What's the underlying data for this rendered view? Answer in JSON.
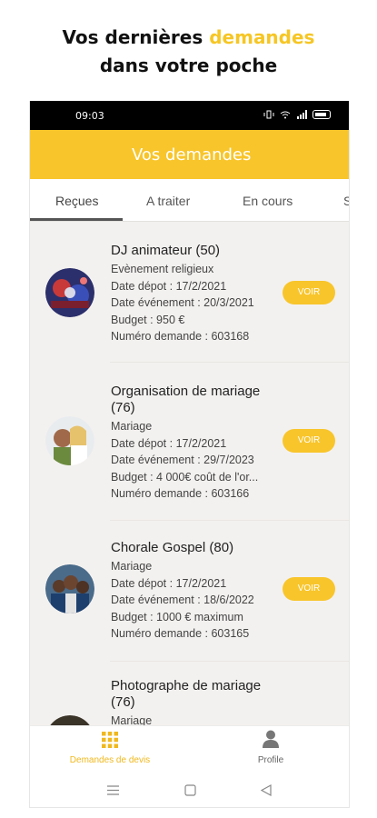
{
  "promo": {
    "line1_prefix": "Vos dernières ",
    "line1_accent": "demandes",
    "line2": "dans votre poche",
    "accent_color": "#f6c624"
  },
  "status_bar": {
    "time": "09:03",
    "icons": [
      "vibrate-icon",
      "wifi-icon",
      "signal-icon",
      "battery-icon"
    ]
  },
  "app_bar": {
    "title": "Vos demandes",
    "color": "#f8c52b"
  },
  "tabs": [
    {
      "label": "Reçues",
      "active": true
    },
    {
      "label": "A traiter",
      "active": false
    },
    {
      "label": "En cours",
      "active": false
    },
    {
      "label": "S",
      "active": false
    }
  ],
  "requests": [
    {
      "title": "DJ animateur (50)",
      "category": "Evènement religieux",
      "date_depot": "Date dépot : 17/2/2021",
      "date_evenement": "Date événement : 20/3/2021",
      "budget": "Budget : 950 €",
      "numero": "Numéro demande : 603168",
      "button": "VOIR"
    },
    {
      "title": "Organisation de mariage (76)",
      "category": "Mariage",
      "date_depot": "Date dépot : 17/2/2021",
      "date_evenement": "Date événement : 29/7/2023",
      "budget": "Budget : 4 000€ coût de l'or...",
      "numero": "Numéro demande : 603166",
      "button": "VOIR"
    },
    {
      "title": "Chorale Gospel (80)",
      "category": "Mariage",
      "date_depot": "Date dépot : 17/2/2021",
      "date_evenement": "Date événement : 18/6/2022",
      "budget": "Budget : 1000 € maximum",
      "numero": "Numéro demande : 603165",
      "button": "VOIR"
    },
    {
      "title": "Photographe de mariage (76)",
      "category": "Mariage"
    }
  ],
  "bottom_nav": [
    {
      "label": "Demandes de devis",
      "icon": "grid-icon",
      "active": true
    },
    {
      "label": "Profile",
      "icon": "person-icon",
      "active": false
    }
  ],
  "system_nav": [
    "menu-icon",
    "home-icon",
    "back-icon"
  ]
}
